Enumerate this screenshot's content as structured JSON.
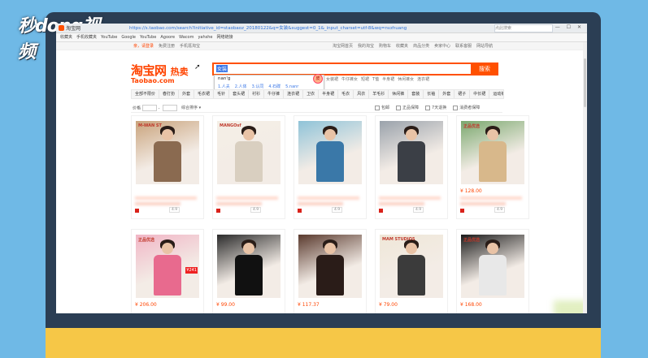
{
  "watermark": "秒dong视频",
  "browser": {
    "tab_title": "淘宝网",
    "url": "https://s.taobao.com/search?initiative_id=staobaoz_20180122&q=女装&suggest=0_1&_input_charset=utf-8&wq=nvzhuang",
    "search_placeholder": "点此搜索",
    "window_controls": "— ☐ ✕",
    "bookmarks": [
      "收藏夹",
      "手机收藏夹",
      "YouTube",
      "Google",
      "YouTube",
      "Agoore",
      "Wacom",
      "yahshe",
      "网络链接"
    ]
  },
  "top_nav": {
    "left": [
      "亲，请登录",
      "免费注册",
      "手机逛淘宝"
    ],
    "right": [
      "淘宝网首页",
      "我的淘宝",
      "购物车",
      "收藏夹",
      "商品分类",
      "卖家中心",
      "联系客服",
      "网站导航"
    ]
  },
  "brand": {
    "cn": "淘宝网",
    "cn_sub": "热卖",
    "en": "Taobao.com"
  },
  "search": {
    "value": "女装",
    "button": "搜索"
  },
  "ime": {
    "composition": "nan'g",
    "candidates": [
      "1.人夫",
      "2.人体",
      "3.认同",
      "4.石碟",
      "5.nanr"
    ],
    "mascot": "皮"
  },
  "hot_words": [
    "女装裙",
    "牛仔裤女",
    "短裙",
    "T恤",
    "半身裙",
    "休闲裤女",
    "连衣裙"
  ],
  "categories": [
    "全部不限价",
    "春打扮",
    "外套",
    "毛衣裙",
    "毛针",
    "套头裙",
    "衬衫",
    "牛仔裤",
    "连衣裙",
    "卫衣",
    "半身裙",
    "毛衣",
    "风衣",
    "羊毛衫",
    "休闲裤",
    "套装",
    "长袖",
    "外套",
    "裙子",
    "中长裙",
    "运动裤",
    "家居服",
    "蕾丝"
  ],
  "filters": {
    "price": "价格",
    "sort": "综合排序",
    "checks": [
      "包邮",
      "正品保障",
      "7天退换",
      "消费者保障"
    ]
  },
  "products": [
    {
      "price": "",
      "brand_text": "M-WAN ST",
      "shop_rating": "4.9",
      "palette": [
        "#c9a37c",
        "#8a6a50"
      ]
    },
    {
      "price": "",
      "brand_text": "MANGOsf",
      "shop_rating": "4.9",
      "palette": [
        "#f4efe6",
        "#d9cfc0"
      ]
    },
    {
      "price": "",
      "brand_text": "",
      "shop_rating": "4.9",
      "palette": [
        "#8fc3d8",
        "#3a78a8"
      ]
    },
    {
      "price": "",
      "brand_text": "",
      "shop_rating": "4.9",
      "palette": [
        "#9aa2ab",
        "#3b3f46"
      ]
    },
    {
      "price": "¥ 128.00",
      "brand_text": "正品优选",
      "shop_rating": "4.9",
      "palette": [
        "#7aa86e",
        "#d8b88b"
      ]
    },
    {
      "price": "¥ 206.00",
      "brand_text": "正品优选",
      "shop_rating": "4.9",
      "palette": [
        "#f1b6c6",
        "#e86a8e"
      ],
      "promo": "¥241"
    },
    {
      "price": "¥ 99.00",
      "brand_text": "",
      "shop_rating": "4.9",
      "palette": [
        "#2b2b2b",
        "#111"
      ]
    },
    {
      "price": "¥ 117.37",
      "brand_text": "",
      "shop_rating": "4.9",
      "palette": [
        "#5a3a2e",
        "#2a1c18"
      ]
    },
    {
      "price": "¥ 79.00",
      "brand_text": "MAM STUDIOS",
      "shop_rating": "4.9",
      "palette": [
        "#efe7d8",
        "#3b3b3b"
      ]
    },
    {
      "price": "¥ 168.00",
      "brand_text": "正品优选",
      "shop_rating": "4.9",
      "palette": [
        "#1a1a1a",
        "#e8e8e8"
      ]
    }
  ]
}
